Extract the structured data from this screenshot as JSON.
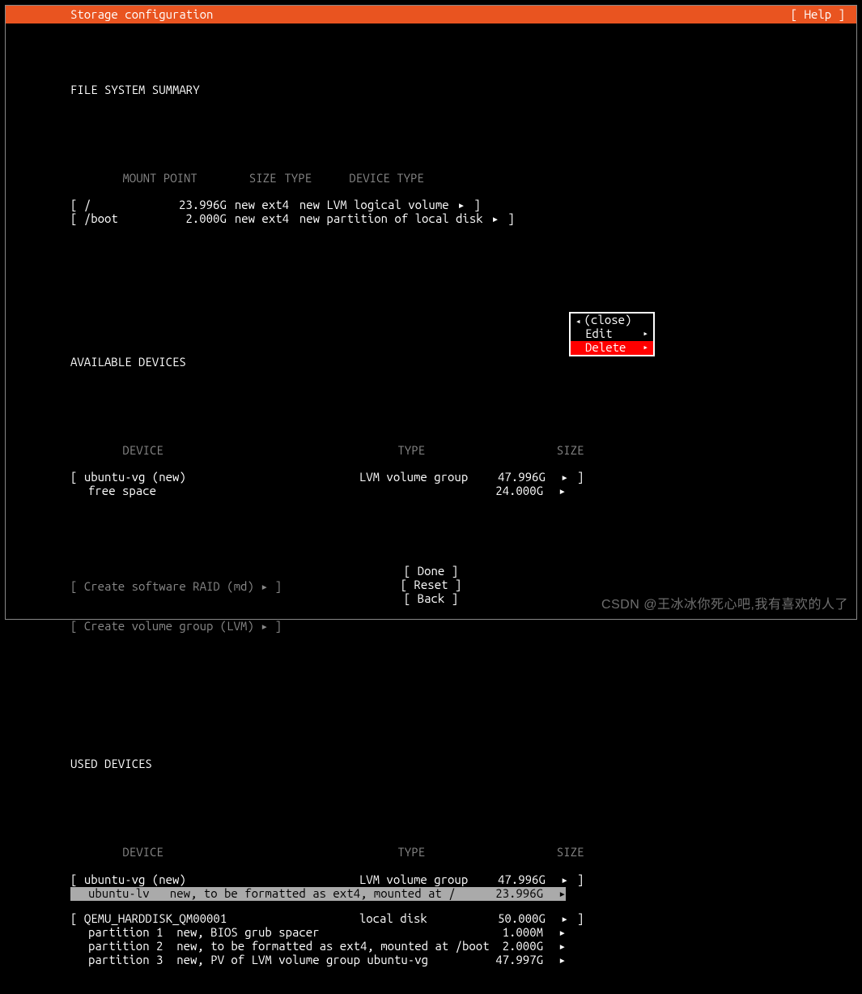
{
  "header": {
    "title": "Storage configuration",
    "help": "[ Help ]"
  },
  "sections": {
    "fs_summary": "FILE SYSTEM SUMMARY",
    "fs_headers": {
      "mount": "MOUNT POINT",
      "size": "SIZE",
      "type": "TYPE",
      "dtype": "DEVICE TYPE"
    },
    "fs_rows": [
      {
        "mount": "/",
        "size": "23.996G",
        "type": "new ext4",
        "dtype": "new LVM logical volume"
      },
      {
        "mount": "/boot",
        "size": "2.000G",
        "type": "new ext4",
        "dtype": "new partition of local disk"
      }
    ],
    "avail_title": "AVAILABLE DEVICES",
    "avail_headers": {
      "device": "DEVICE",
      "type": "TYPE",
      "size": "SIZE"
    },
    "avail_rows": [
      {
        "device": "ubuntu-vg (new)",
        "type": "LVM volume group",
        "size": "47.996G",
        "bracket_close": true
      },
      {
        "device": "free space",
        "type": "",
        "size": "24.000G",
        "indent": true
      }
    ],
    "create_raid": "[ Create software RAID (md) ▸ ]",
    "create_lvm": "[ Create volume group (LVM) ▸ ]",
    "used_title": "USED DEVICES",
    "used_headers": {
      "device": "DEVICE",
      "type": "TYPE",
      "size": "SIZE"
    },
    "used_rows": [
      {
        "device": "ubuntu-vg (new)",
        "type": "LVM volume group",
        "size": "47.996G",
        "bracket": true
      },
      {
        "device": "ubuntu-lv   new, to be formatted as ext4, mounted at /",
        "type": "",
        "size": "23.996G",
        "selected": true,
        "indent": true
      },
      {},
      {
        "device": "QEMU_HARDDISK_QM00001",
        "type": "local disk",
        "size": "50.000G",
        "bracket": true
      },
      {
        "device": "partition 1  new, BIOS grub spacer",
        "type": "",
        "size": "1.000M",
        "indent": true
      },
      {
        "device": "partition 2  new, to be formatted as ext4, mounted at /boot",
        "type": "",
        "size": "2.000G",
        "indent": true
      },
      {
        "device": "partition 3  new, PV of LVM volume group ubuntu-vg",
        "type": "",
        "size": "47.997G",
        "indent": true
      }
    ]
  },
  "context_menu": {
    "close": "(close)",
    "edit": "Edit",
    "delete": "Delete"
  },
  "footer": {
    "done": "[ Done       ]",
    "reset": "[ Reset      ]",
    "back": "[ Back       ]"
  },
  "watermark": "CSDN @王冰冰你死心吧,我有喜欢的人了"
}
